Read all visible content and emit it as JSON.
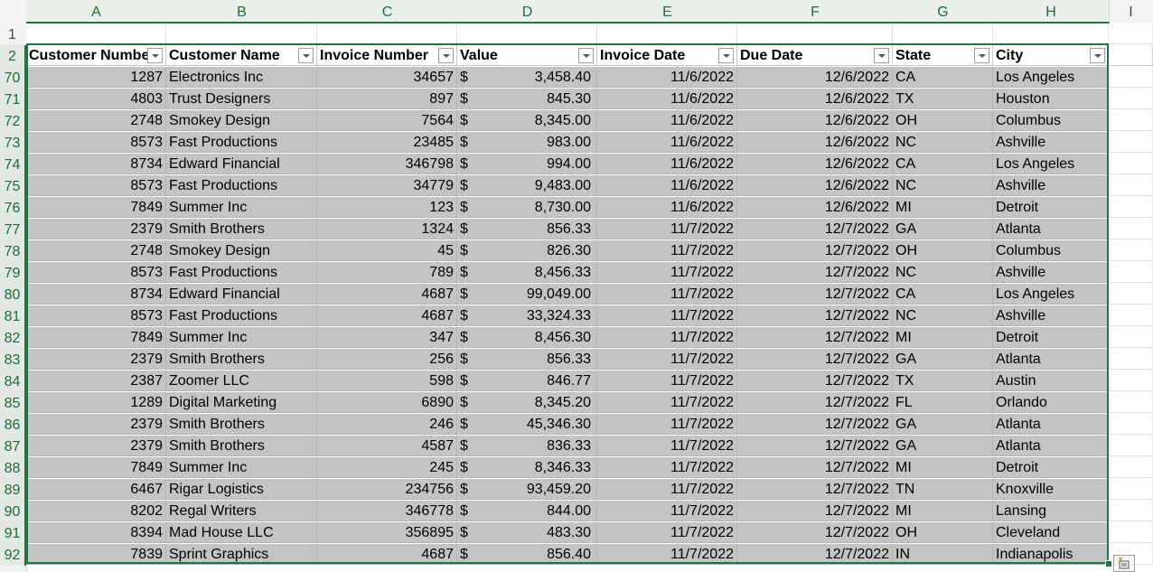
{
  "columns": [
    "A",
    "B",
    "C",
    "D",
    "E",
    "F",
    "G",
    "H",
    "I"
  ],
  "header_row_number": "2",
  "empty_row_number": "1",
  "table_headers": [
    "Customer Numbe",
    "Customer Name",
    "Invoice Number",
    "Value",
    "Invoice Date",
    "Due Date",
    "State",
    "City"
  ],
  "currency_symbol": "$",
  "rows": [
    {
      "n": "70",
      "cust": "1287",
      "name": "Electronics Inc",
      "inv": "34657",
      "val": "3,458.40",
      "idate": "11/6/2022",
      "ddate": "12/6/2022",
      "state": "CA",
      "city": "Los Angeles"
    },
    {
      "n": "71",
      "cust": "4803",
      "name": "Trust Designers",
      "inv": "897",
      "val": "845.30",
      "idate": "11/6/2022",
      "ddate": "12/6/2022",
      "state": "TX",
      "city": "Houston"
    },
    {
      "n": "72",
      "cust": "2748",
      "name": "Smokey Design",
      "inv": "7564",
      "val": "8,345.00",
      "idate": "11/6/2022",
      "ddate": "12/6/2022",
      "state": "OH",
      "city": "Columbus"
    },
    {
      "n": "73",
      "cust": "8573",
      "name": "Fast Productions",
      "inv": "23485",
      "val": "983.00",
      "idate": "11/6/2022",
      "ddate": "12/6/2022",
      "state": "NC",
      "city": "Ashville"
    },
    {
      "n": "74",
      "cust": "8734",
      "name": "Edward Financial",
      "inv": "346798",
      "val": "994.00",
      "idate": "11/6/2022",
      "ddate": "12/6/2022",
      "state": "CA",
      "city": "Los Angeles"
    },
    {
      "n": "75",
      "cust": "8573",
      "name": "Fast Productions",
      "inv": "34779",
      "val": "9,483.00",
      "idate": "11/6/2022",
      "ddate": "12/6/2022",
      "state": "NC",
      "city": "Ashville"
    },
    {
      "n": "76",
      "cust": "7849",
      "name": "Summer Inc",
      "inv": "123",
      "val": "8,730.00",
      "idate": "11/6/2022",
      "ddate": "12/6/2022",
      "state": "MI",
      "city": "Detroit"
    },
    {
      "n": "77",
      "cust": "2379",
      "name": "Smith Brothers",
      "inv": "1324",
      "val": "856.33",
      "idate": "11/7/2022",
      "ddate": "12/7/2022",
      "state": "GA",
      "city": "Atlanta"
    },
    {
      "n": "78",
      "cust": "2748",
      "name": "Smokey Design",
      "inv": "45",
      "val": "826.30",
      "idate": "11/7/2022",
      "ddate": "12/7/2022",
      "state": "OH",
      "city": "Columbus"
    },
    {
      "n": "79",
      "cust": "8573",
      "name": "Fast Productions",
      "inv": "789",
      "val": "8,456.33",
      "idate": "11/7/2022",
      "ddate": "12/7/2022",
      "state": "NC",
      "city": "Ashville"
    },
    {
      "n": "80",
      "cust": "8734",
      "name": "Edward Financial",
      "inv": "4687",
      "val": "99,049.00",
      "idate": "11/7/2022",
      "ddate": "12/7/2022",
      "state": "CA",
      "city": "Los Angeles"
    },
    {
      "n": "81",
      "cust": "8573",
      "name": "Fast Productions",
      "inv": "4687",
      "val": "33,324.33",
      "idate": "11/7/2022",
      "ddate": "12/7/2022",
      "state": "NC",
      "city": "Ashville"
    },
    {
      "n": "82",
      "cust": "7849",
      "name": "Summer Inc",
      "inv": "347",
      "val": "8,456.30",
      "idate": "11/7/2022",
      "ddate": "12/7/2022",
      "state": "MI",
      "city": "Detroit"
    },
    {
      "n": "83",
      "cust": "2379",
      "name": "Smith Brothers",
      "inv": "256",
      "val": "856.33",
      "idate": "11/7/2022",
      "ddate": "12/7/2022",
      "state": "GA",
      "city": "Atlanta"
    },
    {
      "n": "84",
      "cust": "2387",
      "name": "Zoomer LLC",
      "inv": "598",
      "val": "846.77",
      "idate": "11/7/2022",
      "ddate": "12/7/2022",
      "state": "TX",
      "city": "Austin"
    },
    {
      "n": "85",
      "cust": "1289",
      "name": "Digital Marketing",
      "inv": "6890",
      "val": "8,345.20",
      "idate": "11/7/2022",
      "ddate": "12/7/2022",
      "state": "FL",
      "city": "Orlando"
    },
    {
      "n": "86",
      "cust": "2379",
      "name": "Smith Brothers",
      "inv": "246",
      "val": "45,346.30",
      "idate": "11/7/2022",
      "ddate": "12/7/2022",
      "state": "GA",
      "city": "Atlanta"
    },
    {
      "n": "87",
      "cust": "2379",
      "name": "Smith Brothers",
      "inv": "4587",
      "val": "836.33",
      "idate": "11/7/2022",
      "ddate": "12/7/2022",
      "state": "GA",
      "city": "Atlanta"
    },
    {
      "n": "88",
      "cust": "7849",
      "name": "Summer Inc",
      "inv": "245",
      "val": "8,346.33",
      "idate": "11/7/2022",
      "ddate": "12/7/2022",
      "state": "MI",
      "city": "Detroit"
    },
    {
      "n": "89",
      "cust": "6467",
      "name": "Rigar Logistics",
      "inv": "234756",
      "val": "93,459.20",
      "idate": "11/7/2022",
      "ddate": "12/7/2022",
      "state": "TN",
      "city": "Knoxville"
    },
    {
      "n": "90",
      "cust": "8202",
      "name": "Regal Writers",
      "inv": "346778",
      "val": "844.00",
      "idate": "11/7/2022",
      "ddate": "12/7/2022",
      "state": "MI",
      "city": "Lansing"
    },
    {
      "n": "91",
      "cust": "8394",
      "name": "Mad House LLC",
      "inv": "356895",
      "val": "483.30",
      "idate": "11/7/2022",
      "ddate": "12/7/2022",
      "state": "OH",
      "city": "Cleveland"
    },
    {
      "n": "92",
      "cust": "7839",
      "name": "Sprint Graphics",
      "inv": "4687",
      "val": "856.40",
      "idate": "11/7/2022",
      "ddate": "12/7/2022",
      "state": "IN",
      "city": "Indianapolis"
    }
  ],
  "icons": {
    "filter": "filter-dropdown-icon",
    "quick_analysis": "quick-analysis-icon"
  },
  "colors": {
    "selection": "#217346",
    "selected_fill": "#c4c4c4"
  }
}
